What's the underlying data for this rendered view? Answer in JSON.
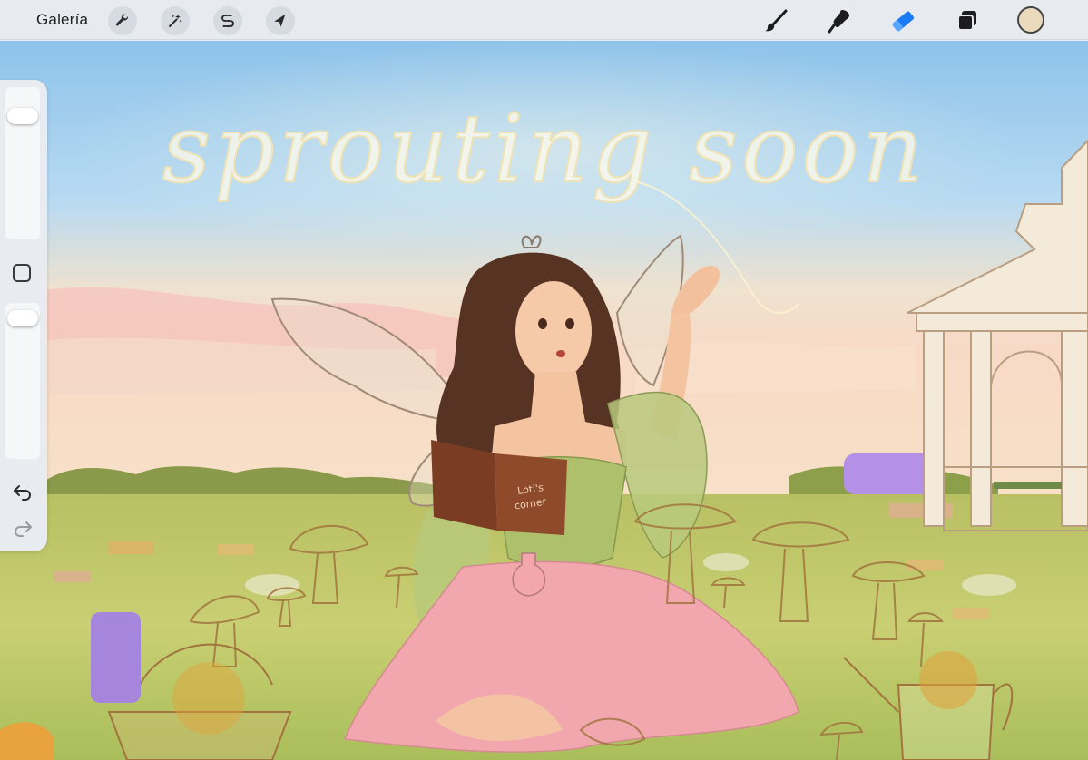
{
  "toolbar": {
    "gallery_label": "Galería",
    "actions": [
      {
        "name": "adjustments",
        "icon": "wrench-icon"
      },
      {
        "name": "selection-magic",
        "icon": "magic-wand-icon"
      },
      {
        "name": "selection",
        "icon": "selection-s-icon"
      },
      {
        "name": "transform",
        "icon": "arrow-cursor-icon"
      }
    ],
    "tools": [
      {
        "name": "brush",
        "icon": "brush-icon"
      },
      {
        "name": "smudge",
        "icon": "smudge-icon"
      },
      {
        "name": "eraser",
        "icon": "eraser-icon",
        "active": true
      },
      {
        "name": "layers",
        "icon": "layers-icon"
      }
    ],
    "active_color": "#ead9bb",
    "accent_color": "#1a7cf5"
  },
  "sidebar": {
    "brush_size": 0.85,
    "opacity": 0.95,
    "undo_icon": "undo-icon",
    "redo_icon": "redo-icon"
  },
  "canvas": {
    "artwork_text": "sprouting soon",
    "book_text_line1": "Loti's",
    "book_text_line2": "corner"
  }
}
